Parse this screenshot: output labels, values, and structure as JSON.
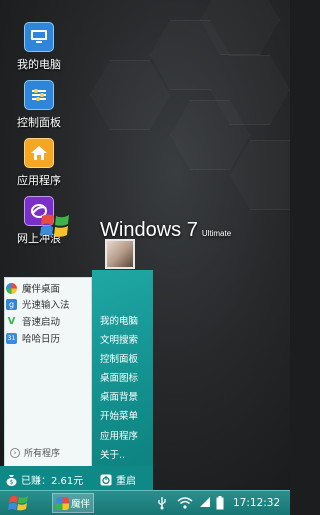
{
  "desktop": {
    "icons": [
      {
        "label": "我的电脑",
        "icon": "computer-icon"
      },
      {
        "label": "控制面板",
        "icon": "control-panel-icon"
      },
      {
        "label": "应用程序",
        "icon": "home-icon"
      },
      {
        "label": "网上冲浪",
        "icon": "browser-icon"
      }
    ],
    "branding": {
      "title": "Windows 7",
      "edition": "Ultimate"
    }
  },
  "start_menu": {
    "apps": [
      {
        "label": "魔伴桌面",
        "icon": "flower-icon"
      },
      {
        "label": "光速输入法",
        "icon": "keyboard-g-icon"
      },
      {
        "label": "音速启动",
        "icon": "v-launch-icon"
      },
      {
        "label": "哈哈日历",
        "icon": "calendar-icon"
      }
    ],
    "all_programs": "所有程序",
    "right_items": [
      "我的电脑",
      "文明搜索",
      "控制面板",
      "桌面图标",
      "桌面背景",
      "开始菜单",
      "应用程序",
      "关于.."
    ],
    "earned": "已赚：2.61元",
    "restart": "重启"
  },
  "taskbar": {
    "active_task": "魔伴",
    "clock": "17:12:32",
    "tray_icons": [
      "usb-icon",
      "wifi-icon",
      "signal-icon",
      "battery-icon"
    ]
  },
  "colors": {
    "accent": "#1fa7a4",
    "taskbar": "#177674"
  }
}
